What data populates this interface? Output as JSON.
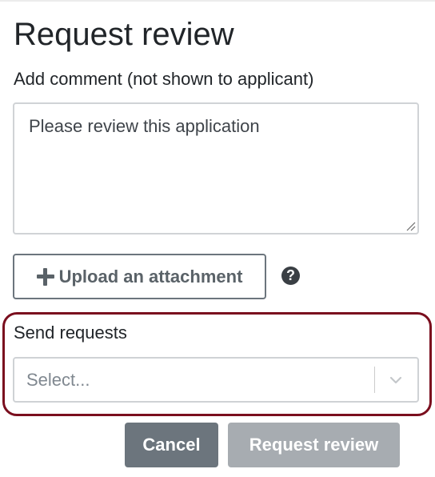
{
  "dialog": {
    "title": "Request review"
  },
  "comment": {
    "label": "Add comment (not shown to applicant)",
    "value": "Please review this application"
  },
  "attachment": {
    "upload_label": "Upload an attachment",
    "plus_icon": "plus-icon",
    "help_icon": "question-circle-icon",
    "help_glyph": "?"
  },
  "send_requests": {
    "label": "Send requests",
    "placeholder": "Select...",
    "dropdown_icon": "chevron-down-icon"
  },
  "actions": {
    "cancel_label": "Cancel",
    "request_label": "Request review"
  },
  "colors": {
    "highlight_border": "#7a0e1e",
    "secondary_button": "#6c757d",
    "disabled_button": "#a7acb1",
    "text": "#212529"
  }
}
